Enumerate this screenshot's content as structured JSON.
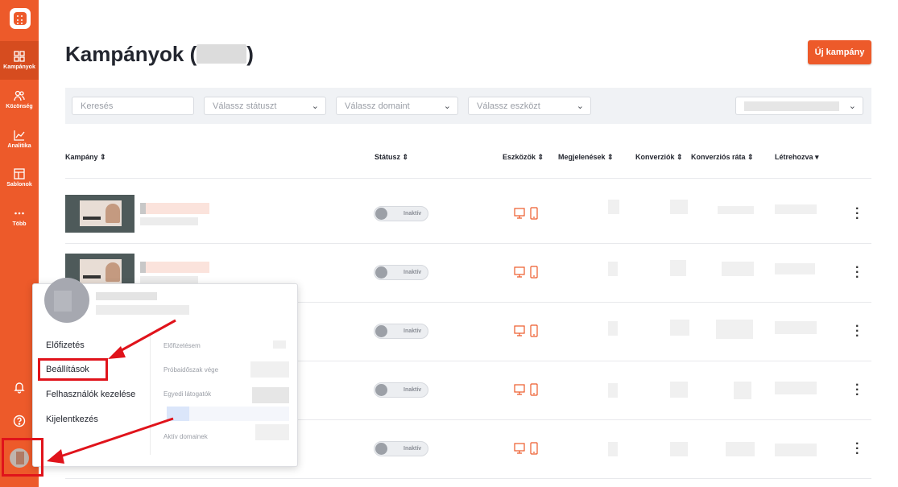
{
  "sidebar": {
    "items": [
      {
        "label": "Kampányok",
        "icon": "grid-icon"
      },
      {
        "label": "Közönség",
        "icon": "users-icon"
      },
      {
        "label": "Analitika",
        "icon": "chart-icon"
      },
      {
        "label": "Sablonok",
        "icon": "template-icon"
      },
      {
        "label": "Több",
        "icon": "more-icon"
      }
    ],
    "active_color": "#d64c1f"
  },
  "header": {
    "title": "Kampányok (",
    "title_close": ")",
    "new_button": "Új kampány"
  },
  "filters": {
    "search_placeholder": "Keresés",
    "status_placeholder": "Válassz státuszt",
    "domain_placeholder": "Válassz domaint",
    "device_placeholder": "Válassz eszközt"
  },
  "table": {
    "columns": [
      "Kampány",
      "Státusz",
      "Eszközök",
      "Megjelenések",
      "Konverziók",
      "Konverziós ráta",
      "Létrehozva"
    ],
    "sort_icons": [
      "⇕",
      "⇕",
      "⇕",
      "⇕",
      "⇕",
      "⇕",
      "▾"
    ],
    "rows": [
      {
        "status": "Inaktív"
      },
      {
        "status": "Inaktív"
      },
      {
        "status": "Inaktív"
      },
      {
        "status": "Inaktív"
      },
      {
        "status": "Inaktív"
      }
    ]
  },
  "popup": {
    "menu": [
      "Előfizetés",
      "Beállítások",
      "Felhasználók kezelése",
      "Kijelentkezés"
    ],
    "info_labels": [
      "Előfizetésem",
      "Próbaidőszak vége",
      "Egyedi látogatók",
      "Aktív domainek"
    ]
  },
  "colors": {
    "brand": "#ed5a2a",
    "annotation": "#e0131b"
  }
}
